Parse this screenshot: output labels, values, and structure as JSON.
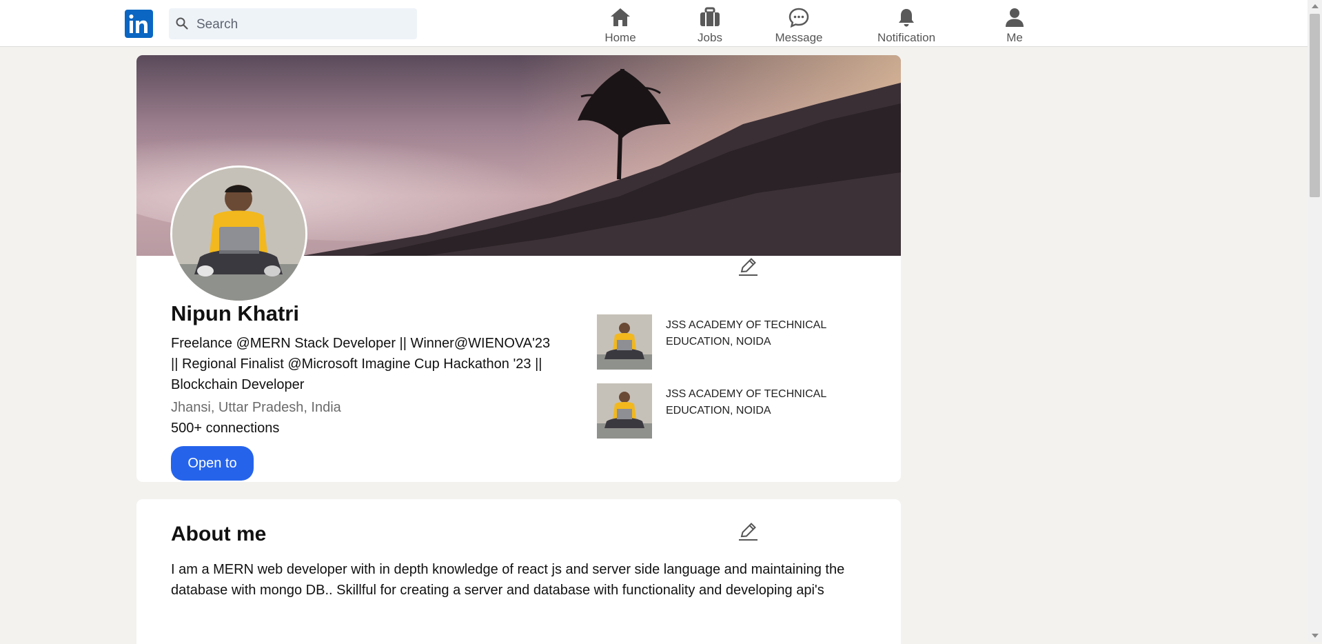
{
  "nav": {
    "logo_text": "in",
    "search": {
      "placeholder": "Search",
      "value": ""
    },
    "items": [
      {
        "label": "Home",
        "icon": "home-icon"
      },
      {
        "label": "Jobs",
        "icon": "briefcase-icon"
      },
      {
        "label": "Message",
        "icon": "message-icon"
      },
      {
        "label": "Notification",
        "icon": "bell-icon"
      },
      {
        "label": "Me",
        "icon": "user-icon"
      }
    ]
  },
  "profile": {
    "name": "Nipun Khatri",
    "headline": "Freelance @MERN Stack Developer || Winner@WIENOVA'23 || Regional Finalist @Microsoft Imagine Cup Hackathon '23 || Blockchain Developer",
    "location": "Jhansi, Uttar Pradesh, India",
    "connections": "500+ connections",
    "open_to_label": "Open to",
    "education": [
      {
        "name": "JSS ACADEMY OF TECHNICAL EDUCATION, NOIDA"
      },
      {
        "name": "JSS ACADEMY OF TECHNICAL EDUCATION, NOIDA"
      }
    ]
  },
  "about": {
    "title": "About me",
    "text": "I am a MERN web developer with in depth knowledge of react js and server side language and maintaining the database with mongo DB.. Skillful for creating a server and database with functionality and developing api's"
  },
  "colors": {
    "brand": "#0a66c2",
    "primary_button": "#2563eb",
    "page_background": "#f3f2ef",
    "muted_text": "#6b6b6b"
  }
}
